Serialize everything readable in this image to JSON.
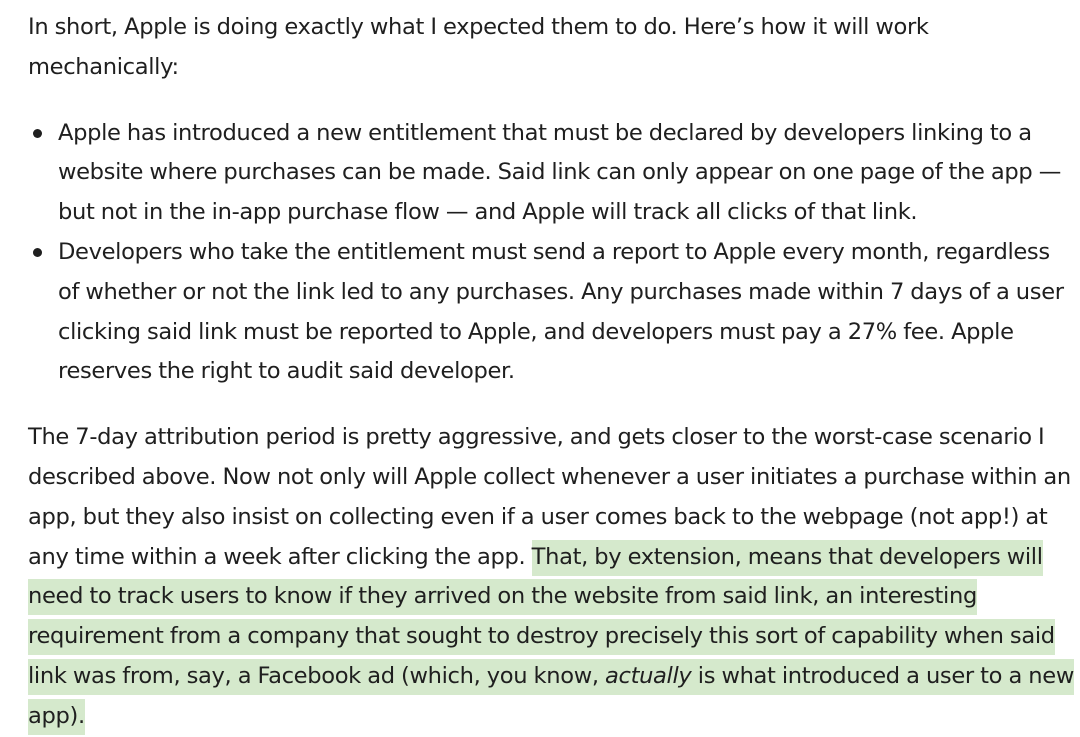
{
  "article": {
    "intro": "In short, Apple is doing exactly what I expected them to do. Here’s how it will work mechanically:",
    "bullets": [
      "Apple has introduced a new entitlement that must be declared by developers linking to a website where purchases can be made. Said link can only appear on one page of the app — but not in the in-app purchase flow — and Apple will track all clicks of that link.",
      "Developers who take the entitlement must send a report to Apple every month, regardless of whether or not the link led to any purchases. Any purchases made within 7 days of a user clicking said link must be reported to Apple, and developers must pay a 27% fee. Apple reserves the right to audit said developer."
    ],
    "closing": {
      "plain": "The 7-day attribution period is pretty aggressive, and gets closer to the worst-case scenario I described above. Now not only will Apple collect whenever a user initiates a purchase within an app, but they also insist on collecting even if a user comes back to the webpage (not app!) at any time within a week after clicking the app. ",
      "highlight_before": "That, by extension, means that developers will need to track users to know if they arrived on the website from said link, an interesting requirement from a company that sought to destroy precisely this sort of capability when said link was from, say, a Facebook ad (which, you know, ",
      "highlight_em": "actually",
      "highlight_after": " is what introduced a user to a new app)."
    },
    "colors": {
      "text": "#1f1f1f",
      "highlight": "#d5e9cc"
    }
  }
}
